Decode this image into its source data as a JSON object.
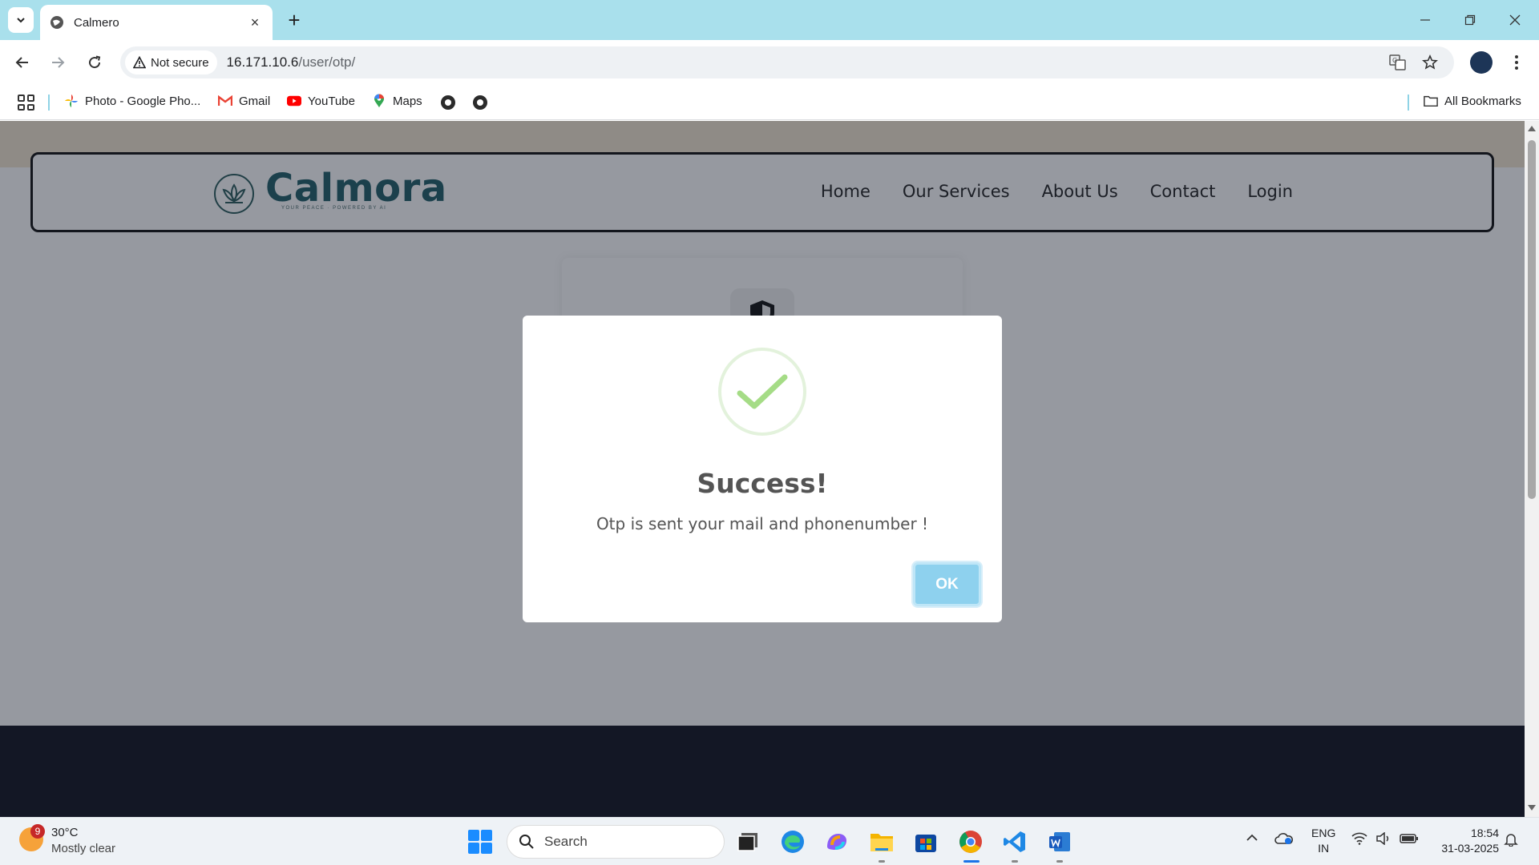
{
  "browser": {
    "tab_title": "Calmero",
    "new_tab_symbol": "+",
    "close_symbol": "×",
    "security_label": "Not secure",
    "url_host": "16.171.10.6",
    "url_path": "/user/otp/",
    "bookmarks": [
      {
        "label": "Photo - Google Pho...",
        "icon": "google-photos-icon"
      },
      {
        "label": "Gmail",
        "icon": "gmail-icon"
      },
      {
        "label": "YouTube",
        "icon": "youtube-icon"
      },
      {
        "label": "Maps",
        "icon": "maps-icon"
      }
    ],
    "all_bookmarks_label": "All Bookmarks"
  },
  "site": {
    "brand": "Calmora",
    "tagline": "YOUR PEACE · POWERED BY AI",
    "nav": [
      "Home",
      "Our Services",
      "About Us",
      "Contact",
      "Login"
    ],
    "brand_color": "#1f5d66"
  },
  "modal": {
    "title": "Success!",
    "message": "Otp is sent your mail and phonenumber !",
    "ok_label": "OK",
    "accent_color": "#8ed1ee",
    "check_color": "#a5dc86"
  },
  "taskbar": {
    "weather_badge": "9",
    "temperature": "30°C",
    "weather_desc": "Mostly clear",
    "search_label": "Search",
    "lang_top": "ENG",
    "lang_bottom": "IN",
    "time": "18:54",
    "date": "31-03-2025"
  }
}
